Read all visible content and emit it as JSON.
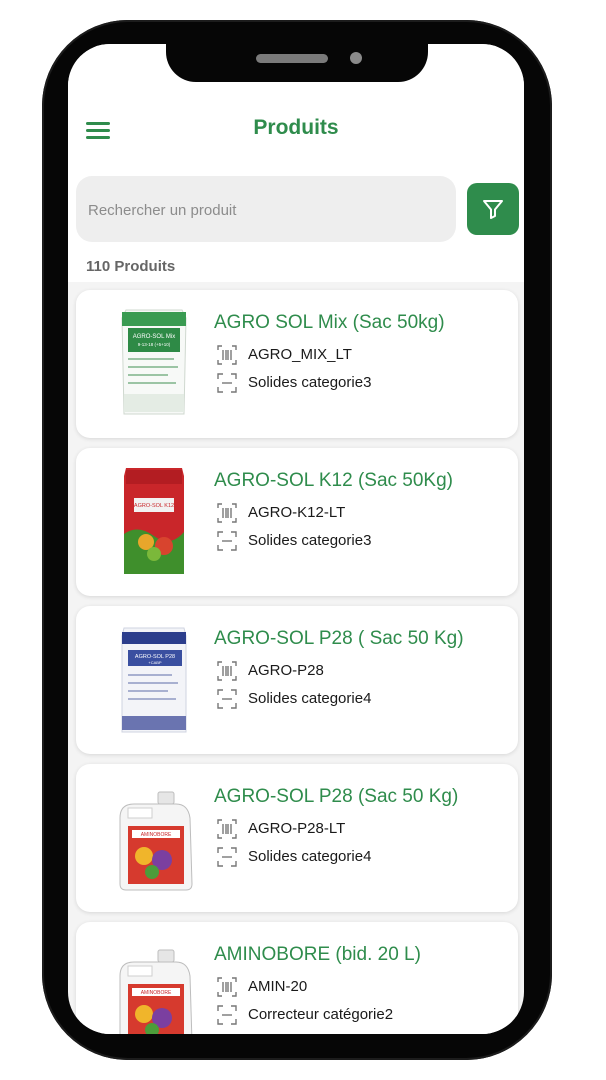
{
  "header": {
    "title": "Produits"
  },
  "search": {
    "placeholder": "Rechercher un produit"
  },
  "list": {
    "count_label": "110 Produits"
  },
  "colors": {
    "primary": "#2f8c4c",
    "text": "#1a1a1a",
    "muted": "#8c8c8c"
  },
  "icons": {
    "menu": "hamburger-menu-icon",
    "filter": "filter-funnel-icon",
    "code": "barcode-icon",
    "category": "scan-frame-icon"
  },
  "products": [
    {
      "name": "AGRO SOL Mix (Sac 50kg)",
      "code": "AGRO_MIX_LT",
      "category": "Solides categorie3",
      "image": "green-white-bag",
      "image_text": [
        "AGRO-SOL Mix",
        "9-13-18 (+5+10)"
      ]
    },
    {
      "name": "AGRO-SOL K12 (Sac 50Kg)",
      "code": "AGRO-K12-LT",
      "category": "Solides categorie3",
      "image": "red-bag",
      "image_text": [
        "AGRO-SOL K12"
      ]
    },
    {
      "name": "AGRO-SOL P28 ( Sac 50 Kg)",
      "code": "AGRO-P28",
      "category": "Solides categorie4",
      "image": "blue-white-bag",
      "image_text": [
        "AGRO-SOL P28",
        "+CABP"
      ]
    },
    {
      "name": "AGRO-SOL P28 (Sac 50 Kg)",
      "code": "AGRO-P28-LT",
      "category": "Solides categorie4",
      "image": "white-jerrican",
      "image_text": [
        "AMINOBORE"
      ]
    },
    {
      "name": "AMINOBORE (bid. 20 L)",
      "code": "AMIN-20",
      "category": "Correcteur catégorie2",
      "image": "white-jerrican",
      "image_text": [
        "AMINOBORE"
      ]
    }
  ]
}
